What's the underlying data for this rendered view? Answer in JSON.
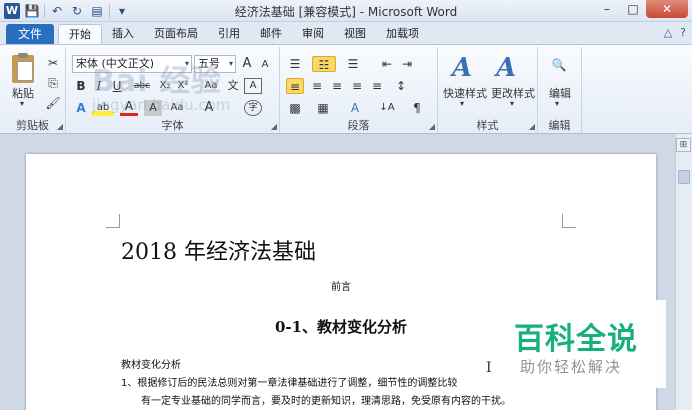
{
  "window": {
    "title": "经济法基础 [兼容模式] - Microsoft Word",
    "app_icon": "W",
    "controls": {
      "minimize": "–",
      "maximize": "□",
      "close": "✕"
    }
  },
  "qat": {
    "save": "💾",
    "undo": "↶",
    "redo": "↻",
    "print": "▤",
    "customize": "▾"
  },
  "tabs": {
    "file": "文件",
    "items": [
      "开始",
      "插入",
      "页面布局",
      "引用",
      "邮件",
      "审阅",
      "视图",
      "加载项"
    ],
    "active": "开始",
    "collapse": "△",
    "help": "?"
  },
  "ribbon": {
    "clipboard": {
      "label": "剪贴板",
      "paste": "粘贴",
      "cut": "✂",
      "copy": "⎘",
      "format_painter": "🖌"
    },
    "font": {
      "label": "字体",
      "name": "宋体 (中文正文)",
      "size": "五号",
      "grow": "A",
      "shrink": "A",
      "clear": "Aa",
      "pinyin": "文",
      "border_char": "A",
      "bold": "B",
      "italic": "I",
      "underline": "U",
      "strike": "abc",
      "sub": "X₂",
      "sup": "X²",
      "effects": "A",
      "highlight": "ab",
      "color": "A",
      "shade": "A",
      "case": "Aa",
      "enclose": "字"
    },
    "paragraph": {
      "label": "段落",
      "bullets": "☰",
      "numbering": "☷",
      "multilevel": "☰",
      "outdent": "⇤",
      "indent": "⇥",
      "align_left": "≡",
      "align_center": "≡",
      "align_right": "≡",
      "justify": "≡",
      "distributed": "≡",
      "line_spacing": "↕",
      "shading": "▩",
      "borders": "▦",
      "chinese_layout": "A",
      "sort": "↓A",
      "show_marks": "¶"
    },
    "styles": {
      "label": "样式",
      "quick": "快速样式",
      "change": "更改样式"
    },
    "editing": {
      "label": "编辑",
      "icon": "🔍",
      "text": "编辑"
    }
  },
  "watermark": {
    "main": "Bai 经验",
    "sub": "jingyan.baidu.com"
  },
  "document": {
    "title": "2018 年经济法基础",
    "preface": "前言",
    "heading": "0-1、教材变化分析",
    "paragraphs": [
      "教材变化分析",
      "1、根据修订后的民法总则对第一章法律基础进行了调整，细节性的调整比较",
      "　　有一定专业基础的同学而言，要及时的更新知识，理清思路，免受原有内容的干扰。"
    ]
  },
  "badge": {
    "main": "百科全说",
    "sub": "助你轻松解决"
  }
}
